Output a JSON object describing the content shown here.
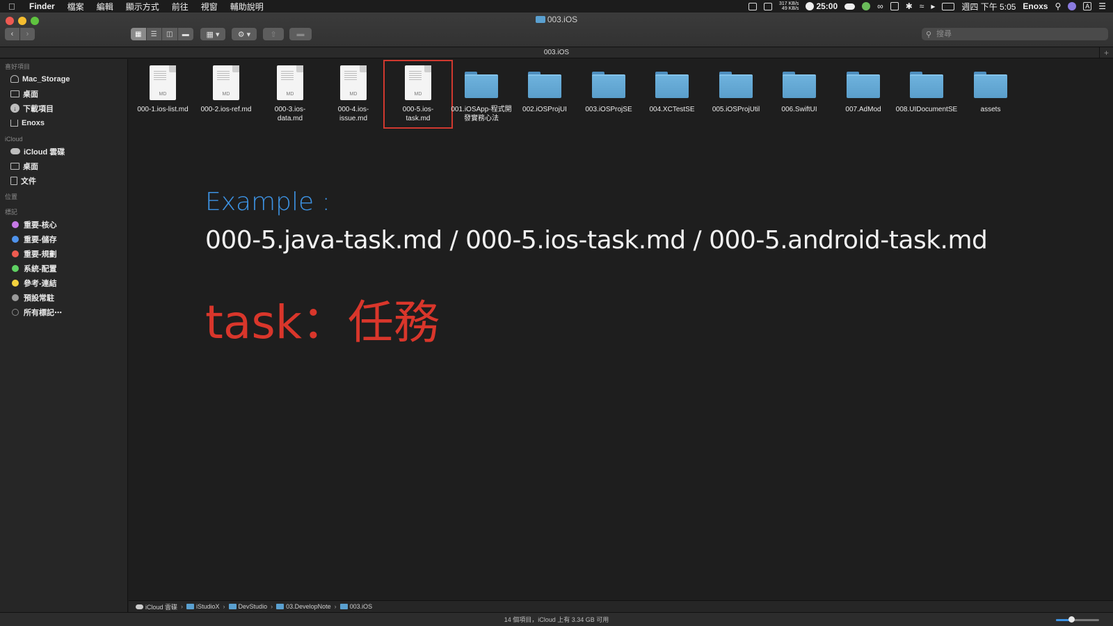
{
  "menubar": {
    "apple_icon": "apple-icon",
    "app_name": "Finder",
    "items": [
      "檔案",
      "編輯",
      "顯示方式",
      "前往",
      "視窗",
      "輔助說明"
    ],
    "net_up": "317 KB/s",
    "net_down": "49 KB/s",
    "timer": "25:00",
    "clock": "週四 下午 5:05",
    "user": "Enoxs",
    "input_source": "A"
  },
  "window": {
    "title": "003.iOS",
    "tab_title": "003.iOS",
    "search": {
      "placeholder": "搜尋",
      "icon": "search-icon"
    }
  },
  "sidebar": {
    "sections": [
      {
        "title": "喜好項目",
        "items": [
          {
            "label": "Mac_Storage",
            "icon": "drive-icon"
          },
          {
            "label": "桌面",
            "icon": "desktop-icon"
          },
          {
            "label": "下載項目",
            "icon": "download-icon"
          },
          {
            "label": "Enoxs",
            "icon": "home-icon"
          }
        ]
      },
      {
        "title": "iCloud",
        "items": [
          {
            "label": "iCloud 雲碟",
            "icon": "cloud-icon"
          },
          {
            "label": "桌面",
            "icon": "desktop-icon"
          },
          {
            "label": "文件",
            "icon": "document-icon"
          }
        ]
      },
      {
        "title": "位置",
        "items": []
      },
      {
        "title": "標記",
        "items": [
          {
            "label": "重要-核心",
            "color": "#c779e6"
          },
          {
            "label": "重要-儲存",
            "color": "#4f93ec"
          },
          {
            "label": "重要-規劃",
            "color": "#ee5b50"
          },
          {
            "label": "系統-配置",
            "color": "#5fd163"
          },
          {
            "label": "參考-連結",
            "color": "#f4d23e"
          },
          {
            "label": "預設常駐",
            "color": "#9b9b9b"
          },
          {
            "label": "所有標記⋯",
            "color": "none"
          }
        ]
      }
    ]
  },
  "files": [
    {
      "name": "000-1.ios-list.md",
      "type": "md",
      "label": "MD"
    },
    {
      "name": "000-2.ios-ref.md",
      "type": "md",
      "label": "MD"
    },
    {
      "name": "000-3.ios-data.md",
      "type": "md",
      "label": "MD"
    },
    {
      "name": "000-4.ios-issue.md",
      "type": "md",
      "label": "MD"
    },
    {
      "name": "000-5.ios-task.md",
      "type": "md",
      "label": "MD",
      "selected": true
    },
    {
      "name": "001.iOSApp-程式開發實務心法",
      "type": "folder"
    },
    {
      "name": "002.iOSProjUI",
      "type": "folder"
    },
    {
      "name": "003.iOSProjSE",
      "type": "folder"
    },
    {
      "name": "004.XCTestSE",
      "type": "folder"
    },
    {
      "name": "005.iOSProjUtil",
      "type": "folder"
    },
    {
      "name": "006.SwiftUI",
      "type": "folder"
    },
    {
      "name": "007.AdMod",
      "type": "folder"
    },
    {
      "name": "008.UIDocumentSE",
      "type": "folder"
    },
    {
      "name": "assets",
      "type": "folder"
    }
  ],
  "overlay": {
    "example_heading": "Example :",
    "example_files": "000-5.java-task.md / 000-5.ios-task.md / 000-5.android-task.md",
    "task_text": "task：任務"
  },
  "pathbar": [
    "iCloud 雲碟",
    "iStudioX",
    "DevStudio",
    "03.DevelopNote",
    "003.iOS"
  ],
  "statusbar": {
    "text": "14 個項目，iCloud 上有 3.34 GB 可用",
    "zoom_level": 0.35
  },
  "colors": {
    "accent": "#3d93e4",
    "highlight_red": "#d9362b",
    "folder_blue": "#5fa5d4"
  }
}
